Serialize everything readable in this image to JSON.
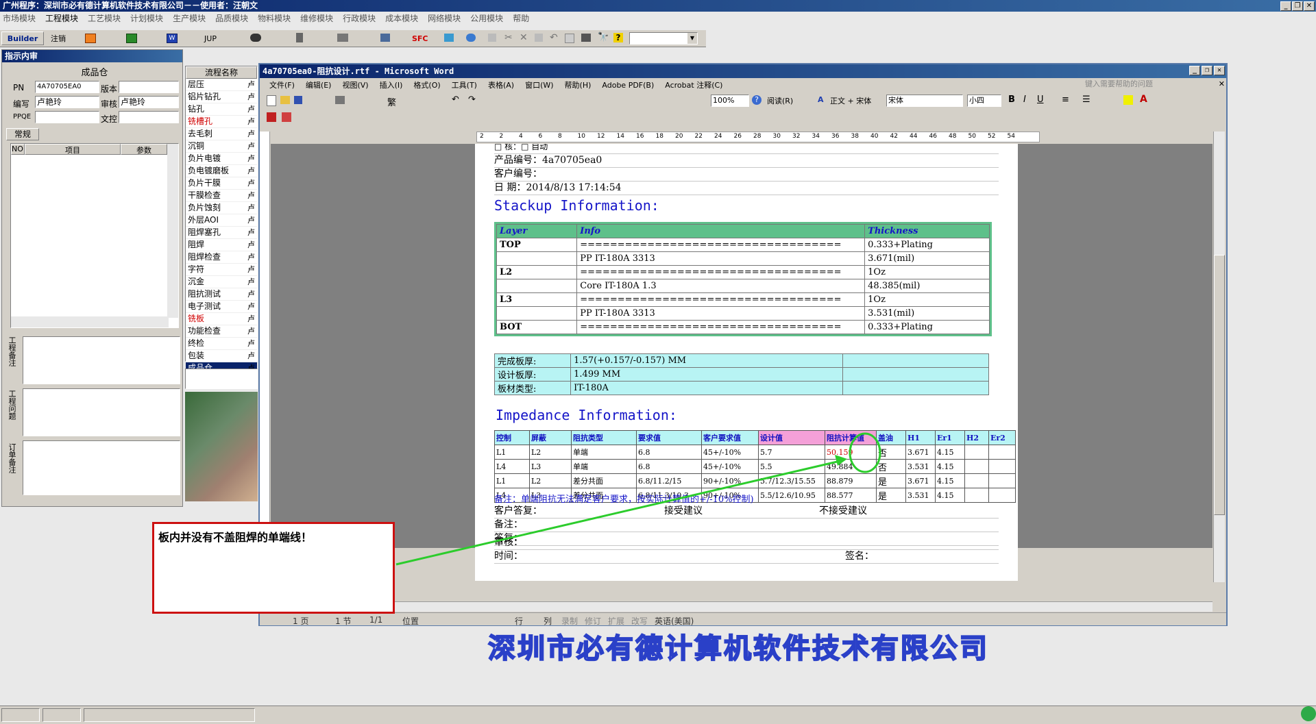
{
  "app": {
    "title": "广州程序：深圳市必有德计算机软件技术有限公司－－使用者：汪朝文",
    "menu": [
      "市场模块",
      "工程模块",
      "工艺模块",
      "计划模块",
      "生产模块",
      "品质模块",
      "物料模块",
      "维修模块",
      "行政模块",
      "成本模块",
      "网络模块",
      "公用模块",
      "帮助"
    ],
    "toolbar": [
      "Builder",
      "注销",
      "JUP",
      "SFC"
    ]
  },
  "review_panel": {
    "title": "指示内审",
    "group_title": "成品仓",
    "fields": {
      "pn_label": "PN",
      "pn_value": "4A70705EA0",
      "version_label": "版本",
      "version_value": "",
      "writer_label": "编写",
      "writer_value": "卢艳玲",
      "audit_label": "审核",
      "audit_value": "卢艳玲",
      "ppqe_label": "PPQE",
      "ppqe_value": "",
      "control_label": "文控",
      "control_value": ""
    },
    "tab": "常规",
    "grid_headers": [
      "NO",
      "项目",
      "参数"
    ],
    "side_labels": [
      "工程备注",
      "工程问题",
      "订单备注"
    ]
  },
  "flow": {
    "header": "流程名称",
    "side_char": "卢",
    "items": [
      {
        "label": "层压",
        "state": ""
      },
      {
        "label": "铝片钻孔",
        "state": ""
      },
      {
        "label": "钻孔",
        "state": ""
      },
      {
        "label": "铣槽孔",
        "state": "red"
      },
      {
        "label": "去毛刺",
        "state": ""
      },
      {
        "label": "沉铜",
        "state": ""
      },
      {
        "label": "负片电镀",
        "state": ""
      },
      {
        "label": "负电镀磨板",
        "state": ""
      },
      {
        "label": "负片干膜",
        "state": ""
      },
      {
        "label": "干膜检查",
        "state": ""
      },
      {
        "label": "负片蚀刻",
        "state": ""
      },
      {
        "label": "外层AOI",
        "state": ""
      },
      {
        "label": "阻焊塞孔",
        "state": ""
      },
      {
        "label": "阻焊",
        "state": ""
      },
      {
        "label": "阻焊检查",
        "state": ""
      },
      {
        "label": "字符",
        "state": ""
      },
      {
        "label": "沉金",
        "state": ""
      },
      {
        "label": "阻抗测试",
        "state": ""
      },
      {
        "label": "电子测试",
        "state": ""
      },
      {
        "label": "铣板",
        "state": "red"
      },
      {
        "label": "功能检查",
        "state": ""
      },
      {
        "label": "终检",
        "state": ""
      },
      {
        "label": "包装",
        "state": ""
      },
      {
        "label": "成品仓",
        "state": "sel"
      }
    ]
  },
  "word": {
    "title": "4a70705ea0-阻抗设计.rtf - Microsoft Word",
    "menu": [
      "文件(F)",
      "编辑(E)",
      "视图(V)",
      "插入(I)",
      "格式(O)",
      "工具(T)",
      "表格(A)",
      "窗口(W)",
      "帮助(H)",
      "Adobe PDF(B)",
      "Acrobat 注释(C)"
    ],
    "help_placeholder": "键入需要帮助的问题",
    "zoom": "100%",
    "read_btn": "阅读(R)",
    "style": "正文 + 宋体",
    "font": "宋体",
    "size": "小四",
    "ruler": [
      "2",
      "2",
      "4",
      "6",
      "8",
      "10",
      "12",
      "14",
      "16",
      "18",
      "20",
      "22",
      "24",
      "26",
      "28",
      "30",
      "32",
      "34",
      "36",
      "38",
      "40",
      "42",
      "44",
      "46",
      "48",
      "50",
      "52",
      "54"
    ],
    "status": {
      "page": "1 页",
      "section": "1 节",
      "pages": "1/1",
      "pos": "位置",
      "line": "行",
      "col": "列",
      "rec": "录制",
      "rev": "修订",
      "ext": "扩展",
      "ovr": "改写",
      "lang": "英语(美国)"
    }
  },
  "doc": {
    "partial_line": "□     核：□ 自动",
    "product_no": "产品编号：4a70705ea0",
    "customer_no": "客户编号：",
    "date": "日    期：2014/8/13 17:14:54",
    "stackup_title": "Stackup Information:",
    "stackup_headers": [
      "Layer",
      "Info",
      "Thickness"
    ],
    "stackup_rows": [
      [
        "TOP",
        "===================================",
        "0.333+Plating"
      ],
      [
        "",
        "PP      IT-180A      3313",
        "3.671(mil)"
      ],
      [
        "L2",
        "===================================",
        "1Oz"
      ],
      [
        "",
        "Core      IT-180A      1.3",
        "48.385(mil)"
      ],
      [
        "L3",
        "===================================",
        "1Oz"
      ],
      [
        "",
        "PP      IT-180A      3313",
        "3.531(mil)"
      ],
      [
        "BOT",
        "===================================",
        "0.333+Plating"
      ]
    ],
    "board_rows": [
      [
        "完成板厚:",
        "1.57(+0.157/-0.157) MM",
        ""
      ],
      [
        "设计板厚:",
        "1.499 MM",
        ""
      ],
      [
        "板材类型:",
        "IT-180A",
        ""
      ]
    ],
    "impedance_title": "Impedance Information:",
    "imp_headers": [
      "控制",
      "屏蔽",
      "阻抗类型",
      "要求值",
      "客户要求值",
      "设计值",
      "阻抗计算值",
      "盖油",
      "H1",
      "Er1",
      "H2",
      "Er2"
    ],
    "imp_rows": [
      [
        "L1",
        "L2",
        "单端",
        "6.8",
        "45+/-10%",
        "5.7",
        "50.159",
        "否",
        "3.671",
        "4.15",
        "",
        ""
      ],
      [
        "L4",
        "L3",
        "单端",
        "6.8",
        "45+/-10%",
        "5.5",
        "49.884",
        "否",
        "3.531",
        "4.15",
        "",
        ""
      ],
      [
        "L1",
        "L2",
        "差分共面",
        "6.8/11.2/15",
        "90+/-10%",
        "5.7/12.3/15.55",
        "88.879",
        "是",
        "3.671",
        "4.15",
        "",
        ""
      ],
      [
        "L4",
        "L3",
        "差分共面",
        "6.8/11.3/10.3",
        "90+/-10%",
        "5.5/12.6/10.95",
        "88.577",
        "是",
        "3.531",
        "4.15",
        "",
        ""
      ]
    ],
    "note": "备注：单端阻抗无法满足客户要求，按实际计算值的+/-10%控制)",
    "reply_label": "客户答复：",
    "accept": "接受建议",
    "reject": "不接受建议",
    "remark_label": "备注：",
    "answer_label": "答复：",
    "audit_label": "审核：",
    "time_label": "时间：",
    "sign_label": "签名："
  },
  "annotation": {
    "text": "板内并没有不盖阻焊的单端线！"
  },
  "watermark": "深圳市必有德计算机软件技术有限公司",
  "colors": {
    "accent_green": "#2ccc2c",
    "callout_red": "#cc1010",
    "doc_blue": "#1515c8",
    "cyan": "#b8f4f4",
    "stack_green": "#5ec08a"
  }
}
